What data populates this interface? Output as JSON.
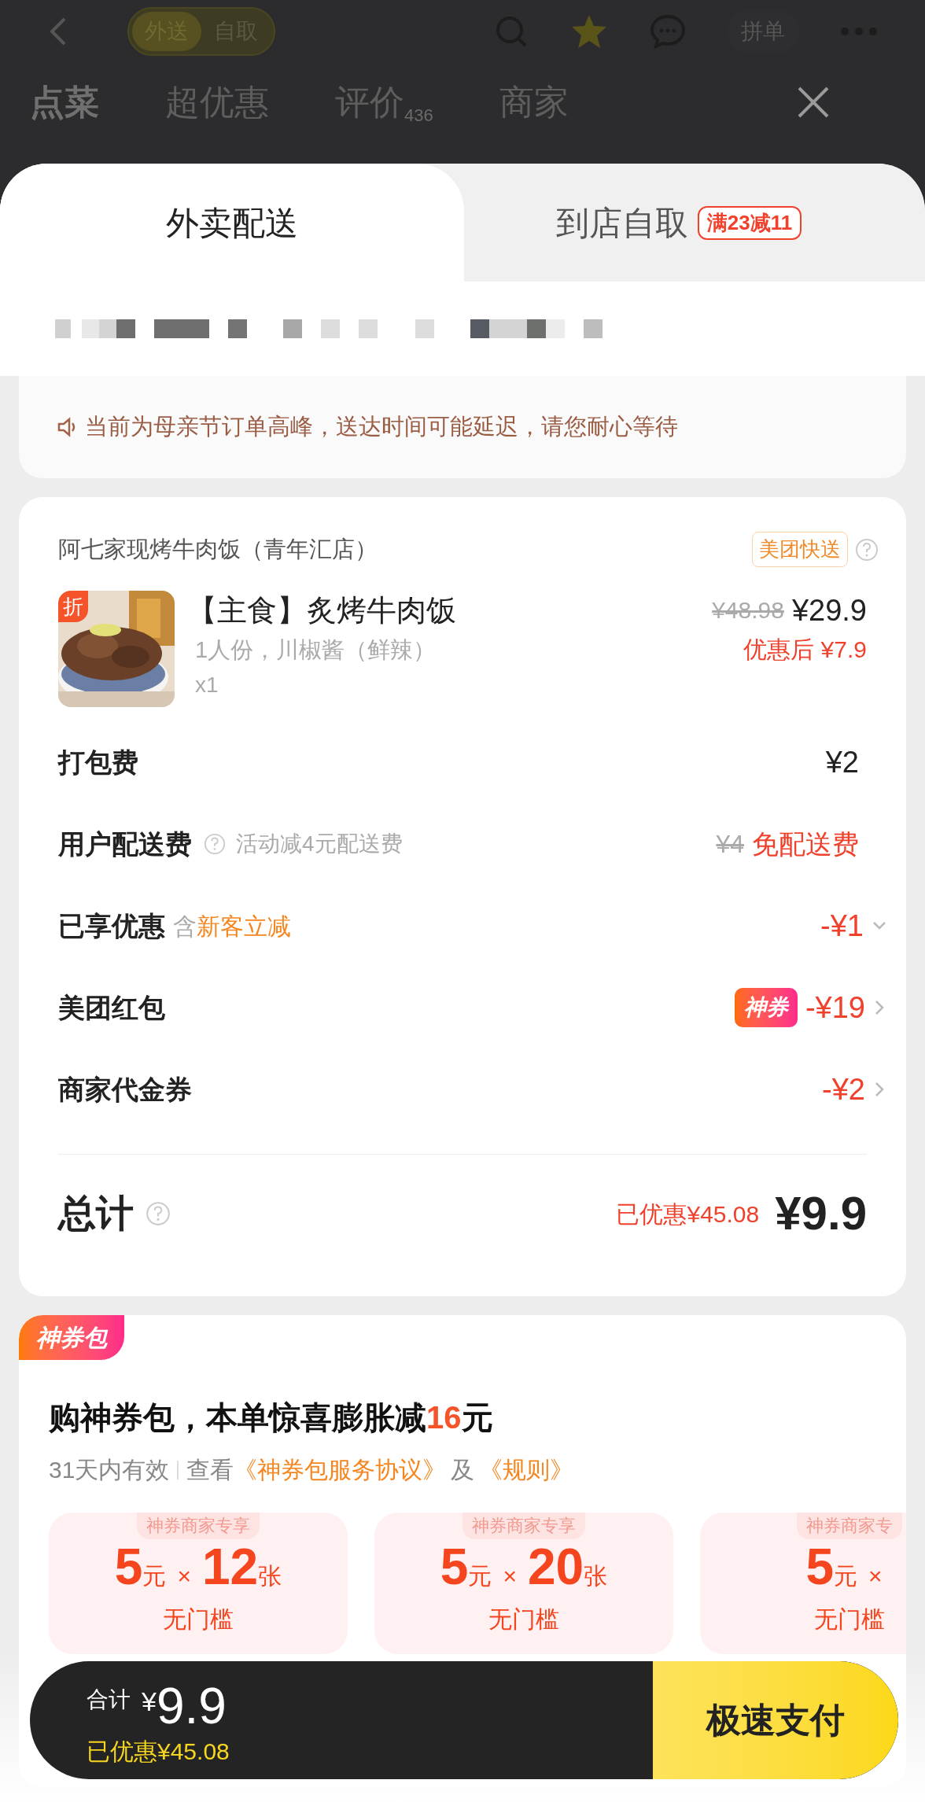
{
  "header": {
    "modes": [
      {
        "label": "外送",
        "selected": true
      },
      {
        "label": "自取",
        "selected": false
      }
    ],
    "group_button": "拼单"
  },
  "store_tabs": [
    {
      "label": "点菜",
      "selected": true
    },
    {
      "label": "超优惠",
      "selected": false
    },
    {
      "label": "评价",
      "count": "436",
      "selected": false
    },
    {
      "label": "商家",
      "selected": false
    }
  ],
  "delivery_tabs": [
    {
      "label": "外卖配送",
      "selected": true
    },
    {
      "label": "到店自取",
      "selected": false,
      "badge": "满23减11"
    }
  ],
  "notice": "当前为母亲节订单高峰，送达时间可能延迟，请您耐心等待",
  "order": {
    "store": "阿七家现烤牛肉饭（青年汇店）",
    "delivery_tag": "美团快送",
    "item": {
      "badge": "折",
      "name": "【主食】炙烤牛肉饭",
      "spec": "1人份，川椒酱（鲜辣）",
      "qty": "x1",
      "original_price": "¥48.98",
      "price": "¥29.9",
      "after_discount": "优惠后 ¥7.9"
    },
    "fees": [
      {
        "kind": "plain",
        "label": "打包费",
        "value": "¥2"
      },
      {
        "kind": "delivery",
        "label": "用户配送费",
        "note": "活动减4元配送费",
        "old_value": "¥4",
        "value": "免配送费"
      },
      {
        "kind": "discount",
        "label": "已享优惠",
        "prefix": "含",
        "highlight": "新客立减",
        "value": "-¥1"
      },
      {
        "kind": "coupon",
        "label": "美团红包",
        "tag": "神券",
        "value": "-¥19"
      },
      {
        "kind": "coupon",
        "label": "商家代金券",
        "value": "-¥2"
      }
    ],
    "total_label": "总计",
    "saved": "已优惠¥45.08",
    "total": "¥9.9"
  },
  "voucher_pack": {
    "ribbon": "神券包",
    "headline": "购神券包，本单惊喜膨胀减**16**元",
    "validity": "31天内有效",
    "view": "查看",
    "agreement_link": "《神券包服务协议》",
    "and": "及",
    "rules_link": "《规则》",
    "coupons": [
      {
        "tag": "神券商家专享",
        "amount": "5",
        "unit": "元",
        "times": "×",
        "count": "12",
        "count_unit": "张",
        "condition": "无门槛"
      },
      {
        "tag": "神券商家专享",
        "amount": "5",
        "unit": "元",
        "times": "×",
        "count": "20",
        "count_unit": "张",
        "condition": "无门槛"
      },
      {
        "tag": "神券商家专",
        "amount": "5",
        "unit": "元",
        "times": "×",
        "condition": "无门槛"
      }
    ]
  },
  "pay_bar": {
    "total_label": "合计",
    "currency": "¥",
    "total": "9.9",
    "saved": "已优惠¥45.08",
    "pay_button": "极速支付"
  }
}
